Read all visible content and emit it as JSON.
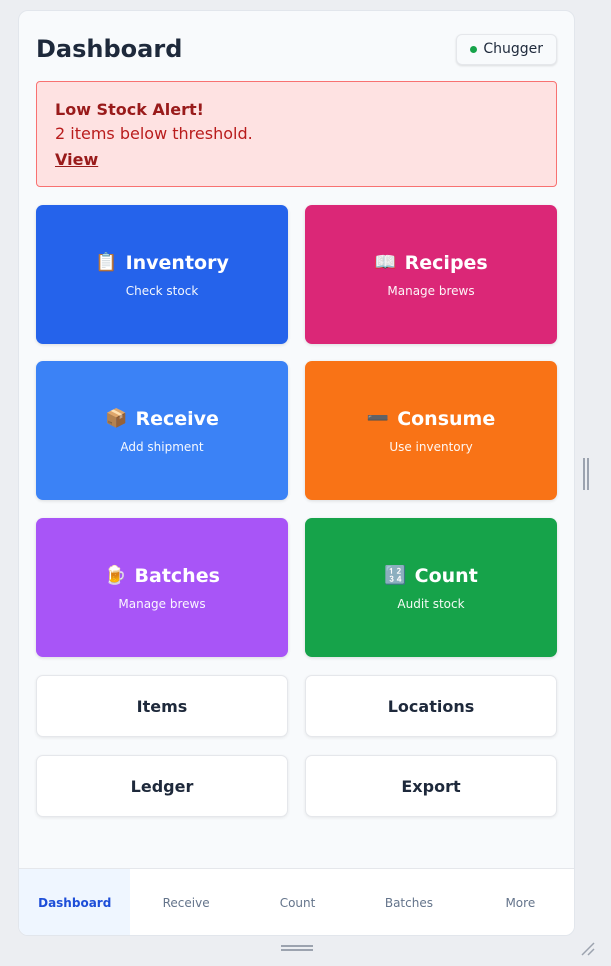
{
  "header": {
    "title": "Dashboard",
    "user": "Chugger",
    "status_color": "#16a34a"
  },
  "alert": {
    "title": "Low Stock Alert!",
    "message": "2 items below threshold.",
    "link": "View"
  },
  "tiles": [
    {
      "icon": "clipboard-icon",
      "glyph": "📋",
      "label": "Inventory",
      "sub": "Check stock",
      "color": "#2563eb"
    },
    {
      "icon": "book-icon",
      "glyph": "📖",
      "label": "Recipes",
      "sub": "Manage brews",
      "color": "#db2777"
    },
    {
      "icon": "package-icon",
      "glyph": "📦",
      "label": "Receive",
      "sub": "Add shipment",
      "color": "#3b82f6"
    },
    {
      "icon": "minus-icon",
      "glyph": "➖",
      "label": "Consume",
      "sub": "Use inventory",
      "color": "#f97316"
    },
    {
      "icon": "beer-mug-icon",
      "glyph": "🍺",
      "label": "Batches",
      "sub": "Manage brews",
      "color": "#a855f7"
    },
    {
      "icon": "numbers-icon",
      "glyph": "🔢",
      "label": "Count",
      "sub": "Audit stock",
      "color": "#16a34a"
    }
  ],
  "secondary": [
    "Items",
    "Locations",
    "Ledger",
    "Export"
  ],
  "nav": {
    "active": "Dashboard",
    "items": [
      "Dashboard",
      "Receive",
      "Count",
      "Batches",
      "More"
    ]
  }
}
